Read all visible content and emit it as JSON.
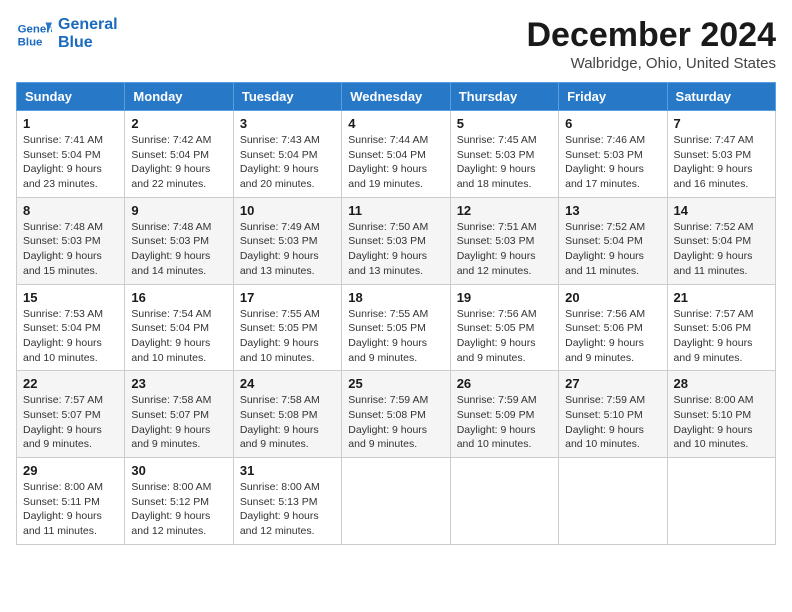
{
  "header": {
    "logo_line1": "General",
    "logo_line2": "Blue",
    "month_title": "December 2024",
    "location": "Walbridge, Ohio, United States"
  },
  "weekdays": [
    "Sunday",
    "Monday",
    "Tuesday",
    "Wednesday",
    "Thursday",
    "Friday",
    "Saturday"
  ],
  "weeks": [
    [
      {
        "day": "1",
        "info": "Sunrise: 7:41 AM\nSunset: 5:04 PM\nDaylight: 9 hours\nand 23 minutes."
      },
      {
        "day": "2",
        "info": "Sunrise: 7:42 AM\nSunset: 5:04 PM\nDaylight: 9 hours\nand 22 minutes."
      },
      {
        "day": "3",
        "info": "Sunrise: 7:43 AM\nSunset: 5:04 PM\nDaylight: 9 hours\nand 20 minutes."
      },
      {
        "day": "4",
        "info": "Sunrise: 7:44 AM\nSunset: 5:04 PM\nDaylight: 9 hours\nand 19 minutes."
      },
      {
        "day": "5",
        "info": "Sunrise: 7:45 AM\nSunset: 5:03 PM\nDaylight: 9 hours\nand 18 minutes."
      },
      {
        "day": "6",
        "info": "Sunrise: 7:46 AM\nSunset: 5:03 PM\nDaylight: 9 hours\nand 17 minutes."
      },
      {
        "day": "7",
        "info": "Sunrise: 7:47 AM\nSunset: 5:03 PM\nDaylight: 9 hours\nand 16 minutes."
      }
    ],
    [
      {
        "day": "8",
        "info": "Sunrise: 7:48 AM\nSunset: 5:03 PM\nDaylight: 9 hours\nand 15 minutes."
      },
      {
        "day": "9",
        "info": "Sunrise: 7:48 AM\nSunset: 5:03 PM\nDaylight: 9 hours\nand 14 minutes."
      },
      {
        "day": "10",
        "info": "Sunrise: 7:49 AM\nSunset: 5:03 PM\nDaylight: 9 hours\nand 13 minutes."
      },
      {
        "day": "11",
        "info": "Sunrise: 7:50 AM\nSunset: 5:03 PM\nDaylight: 9 hours\nand 13 minutes."
      },
      {
        "day": "12",
        "info": "Sunrise: 7:51 AM\nSunset: 5:03 PM\nDaylight: 9 hours\nand 12 minutes."
      },
      {
        "day": "13",
        "info": "Sunrise: 7:52 AM\nSunset: 5:04 PM\nDaylight: 9 hours\nand 11 minutes."
      },
      {
        "day": "14",
        "info": "Sunrise: 7:52 AM\nSunset: 5:04 PM\nDaylight: 9 hours\nand 11 minutes."
      }
    ],
    [
      {
        "day": "15",
        "info": "Sunrise: 7:53 AM\nSunset: 5:04 PM\nDaylight: 9 hours\nand 10 minutes."
      },
      {
        "day": "16",
        "info": "Sunrise: 7:54 AM\nSunset: 5:04 PM\nDaylight: 9 hours\nand 10 minutes."
      },
      {
        "day": "17",
        "info": "Sunrise: 7:55 AM\nSunset: 5:05 PM\nDaylight: 9 hours\nand 10 minutes."
      },
      {
        "day": "18",
        "info": "Sunrise: 7:55 AM\nSunset: 5:05 PM\nDaylight: 9 hours\nand 9 minutes."
      },
      {
        "day": "19",
        "info": "Sunrise: 7:56 AM\nSunset: 5:05 PM\nDaylight: 9 hours\nand 9 minutes."
      },
      {
        "day": "20",
        "info": "Sunrise: 7:56 AM\nSunset: 5:06 PM\nDaylight: 9 hours\nand 9 minutes."
      },
      {
        "day": "21",
        "info": "Sunrise: 7:57 AM\nSunset: 5:06 PM\nDaylight: 9 hours\nand 9 minutes."
      }
    ],
    [
      {
        "day": "22",
        "info": "Sunrise: 7:57 AM\nSunset: 5:07 PM\nDaylight: 9 hours\nand 9 minutes."
      },
      {
        "day": "23",
        "info": "Sunrise: 7:58 AM\nSunset: 5:07 PM\nDaylight: 9 hours\nand 9 minutes."
      },
      {
        "day": "24",
        "info": "Sunrise: 7:58 AM\nSunset: 5:08 PM\nDaylight: 9 hours\nand 9 minutes."
      },
      {
        "day": "25",
        "info": "Sunrise: 7:59 AM\nSunset: 5:08 PM\nDaylight: 9 hours\nand 9 minutes."
      },
      {
        "day": "26",
        "info": "Sunrise: 7:59 AM\nSunset: 5:09 PM\nDaylight: 9 hours\nand 10 minutes."
      },
      {
        "day": "27",
        "info": "Sunrise: 7:59 AM\nSunset: 5:10 PM\nDaylight: 9 hours\nand 10 minutes."
      },
      {
        "day": "28",
        "info": "Sunrise: 8:00 AM\nSunset: 5:10 PM\nDaylight: 9 hours\nand 10 minutes."
      }
    ],
    [
      {
        "day": "29",
        "info": "Sunrise: 8:00 AM\nSunset: 5:11 PM\nDaylight: 9 hours\nand 11 minutes."
      },
      {
        "day": "30",
        "info": "Sunrise: 8:00 AM\nSunset: 5:12 PM\nDaylight: 9 hours\nand 12 minutes."
      },
      {
        "day": "31",
        "info": "Sunrise: 8:00 AM\nSunset: 5:13 PM\nDaylight: 9 hours\nand 12 minutes."
      },
      null,
      null,
      null,
      null
    ]
  ]
}
